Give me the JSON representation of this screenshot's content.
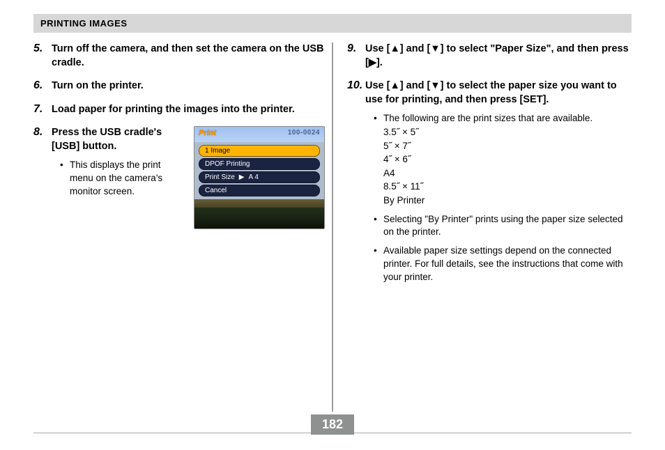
{
  "header": "PRINTING IMAGES",
  "page_number": "182",
  "left": {
    "steps": [
      {
        "num": "5.",
        "title": "Turn off the camera, and then set the camera on the USB cradle."
      },
      {
        "num": "6.",
        "title": "Turn on the printer."
      },
      {
        "num": "7.",
        "title": "Load paper for printing the images into the printer."
      }
    ],
    "step8": {
      "num": "8.",
      "title": "Press the USB cradle's [USB] button.",
      "bullet": "This displays the print menu on the camera's monitor screen."
    }
  },
  "lcd": {
    "title": "Print",
    "code": "100-0024",
    "rows": {
      "r1": "1 Image",
      "r2": "DPOF Printing",
      "r3_label": "Print Size",
      "r3_arrow": "▶",
      "r3_value": "A 4",
      "r4": "Cancel"
    }
  },
  "right": {
    "step9": {
      "num": "9.",
      "title": "Use [▲] and [▼] to select \"Paper Size\", and then press [▶]."
    },
    "step10": {
      "num": "10.",
      "title": "Use [▲] and [▼] to select the paper size you want to use for printing, and then press [SET].",
      "bullet_intro": "The following are the print sizes that are available.",
      "sizes": {
        "s1": "3.5˝ × 5˝",
        "s2": "5˝ × 7˝",
        "s3": "4˝ × 6˝",
        "s4": "A4",
        "s5": "8.5˝ × 11˝",
        "s6": "By Printer"
      },
      "bullet2": "Selecting \"By Printer\" prints using the paper size selected on the printer.",
      "bullet3": "Available paper size settings depend on the connected printer. For full details, see the instructions that come with your printer."
    }
  }
}
